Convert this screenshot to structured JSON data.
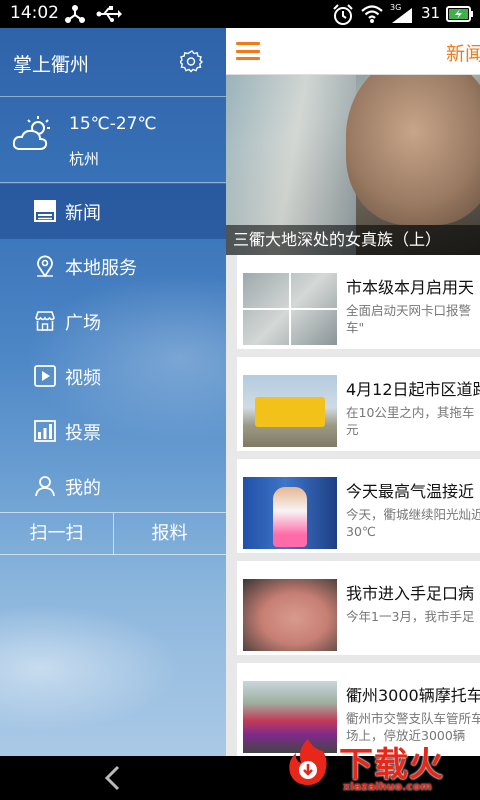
{
  "status_bar": {
    "time": "14:02",
    "battery_level": "31",
    "signal_label": "3G",
    "icons": [
      "share-icon",
      "usb-icon",
      "alarm-icon",
      "wifi-icon",
      "signal-icon",
      "battery-icon"
    ]
  },
  "drawer": {
    "app_title": "掌上衢州",
    "weather": {
      "temperature": "15℃-27℃",
      "city": "杭州"
    },
    "menu": [
      {
        "label": "新闻",
        "icon": "news-icon",
        "active": true
      },
      {
        "label": "本地服务",
        "icon": "location-pin-icon",
        "active": false
      },
      {
        "label": "广场",
        "icon": "storefront-icon",
        "active": false
      },
      {
        "label": "视频",
        "icon": "play-icon",
        "active": false
      },
      {
        "label": "投票",
        "icon": "bar-chart-icon",
        "active": false
      },
      {
        "label": "我的",
        "icon": "person-icon",
        "active": false
      }
    ],
    "quick_actions": {
      "scan": "扫一扫",
      "report": "报料"
    }
  },
  "content": {
    "header_title": "新闻",
    "hero": {
      "caption": "三衢大地深处的女真族（上）"
    },
    "news": [
      {
        "title": "市本级本月启用天",
        "summary": "全面启动天网卡口报警车\""
      },
      {
        "title": "4月12日起市区道路",
        "summary": "在10公里之内，其拖车元"
      },
      {
        "title": "今天最高气温接近",
        "summary": "今天，衢城继续阳光灿近30℃"
      },
      {
        "title": "我市进入手足口病",
        "summary": "今年1一3月，我市手足"
      },
      {
        "title": "衢州3000辆摩托车",
        "summary": "衢州市交警支队车管所车场上，停放近3000辆"
      }
    ]
  },
  "watermark": {
    "main": "下载火",
    "sub": "xiazaihuo.com"
  },
  "colors": {
    "accent": "#f07b1b",
    "drawer_top": "#2f63a9",
    "drawer_bottom": "#aac9e6",
    "watermark": "#e8261a"
  }
}
